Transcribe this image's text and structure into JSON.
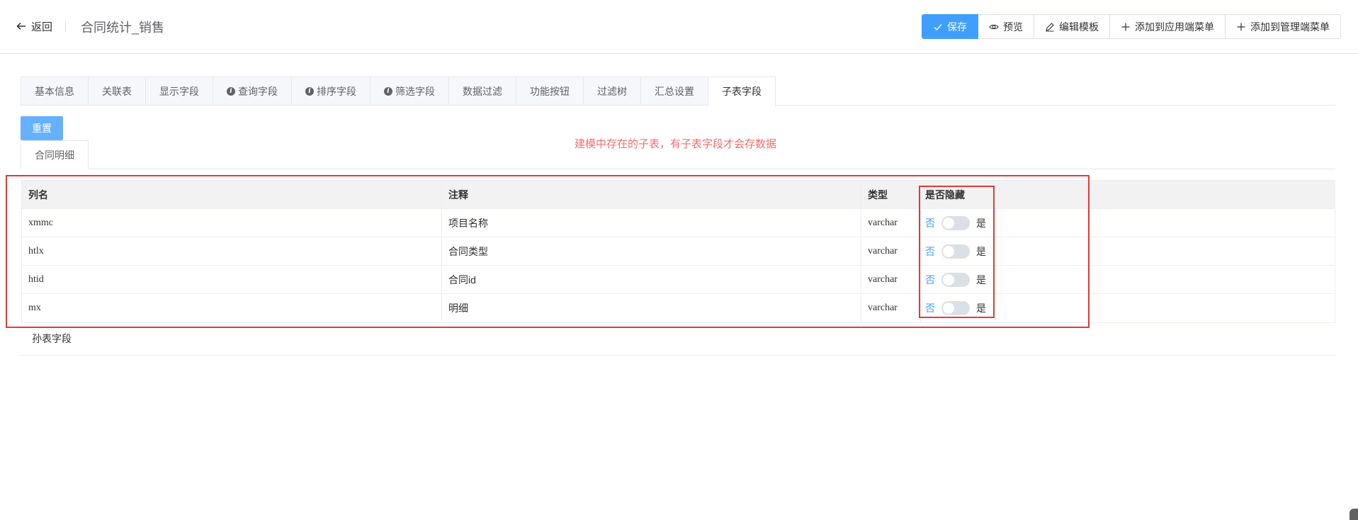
{
  "header": {
    "back_label": "返回",
    "title": "合同统计_销售",
    "buttons": {
      "save": "保存",
      "preview": "预览",
      "edit_template": "编辑模板",
      "add_app_menu": "添加到应用端菜单",
      "add_admin_menu": "添加到管理端菜单"
    }
  },
  "tabs": [
    {
      "label": "基本信息",
      "info": false
    },
    {
      "label": "关联表",
      "info": false
    },
    {
      "label": "显示字段",
      "info": false
    },
    {
      "label": "查询字段",
      "info": true
    },
    {
      "label": "排序字段",
      "info": true
    },
    {
      "label": "筛选字段",
      "info": true
    },
    {
      "label": "数据过滤",
      "info": false
    },
    {
      "label": "功能按钮",
      "info": false
    },
    {
      "label": "过滤树",
      "info": false
    },
    {
      "label": "汇总设置",
      "info": false
    },
    {
      "label": "子表字段",
      "info": false,
      "active": true
    }
  ],
  "reset_label": "重置",
  "note": "建模中存在的子表，有子表字段才会存数据",
  "sub_tab": "合同明细",
  "table": {
    "headers": [
      "列名",
      "注释",
      "类型",
      "是否隐藏"
    ],
    "rows": [
      {
        "name": "xmmc",
        "comment": "项目名称",
        "type": "varchar"
      },
      {
        "name": "htlx",
        "comment": "合同类型",
        "type": "varchar"
      },
      {
        "name": "htid",
        "comment": "合同id",
        "type": "varchar"
      },
      {
        "name": "mx",
        "comment": "明细",
        "type": "varchar"
      }
    ],
    "switch_no": "否",
    "switch_yes": "是"
  },
  "grand_section_title": "孙表字段",
  "colors": {
    "primary": "#409eff",
    "annotation_red": "#e53935",
    "note_red": "#f56c6c"
  }
}
